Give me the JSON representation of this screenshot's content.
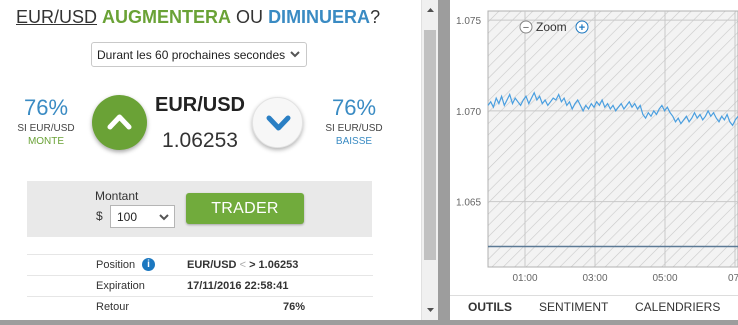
{
  "headline": {
    "pair": "EUR/USD",
    "up_word": "AUGMENTERA",
    "or_word": "OU",
    "down_word": "DIMINUERA",
    "question_mark": "?"
  },
  "duration": {
    "selected": "Durant les 60 prochaines secondes"
  },
  "up": {
    "percent": "76%",
    "si": "SI EUR/USD",
    "label": "MONTE"
  },
  "down": {
    "percent": "76%",
    "si": "SI EUR/USD",
    "label": "BAISSE"
  },
  "asset": {
    "pair": "EUR/USD",
    "price": "1.06253"
  },
  "amount": {
    "label": "Montant",
    "currency": "$",
    "value": "100"
  },
  "trade_button": "TRADER",
  "info": {
    "position_label": "Position",
    "position_pair": "EUR/USD",
    "position_arrow": "<",
    "position_value": "> 1.06253",
    "expiration_label": "Expiration",
    "expiration_value": "17/11/2016 22:58:41",
    "return_label": "Retour",
    "return_value": "76%"
  },
  "chart": {
    "zoom_label": "Zoom",
    "zoom_out": "−",
    "zoom_in": "+"
  },
  "tabs": [
    "OUTILS",
    "SENTIMENT",
    "CALENDRIERS"
  ],
  "colors": {
    "up_green": "#6aa236",
    "down_blue": "#3a8bc3",
    "price_line": "#4a9fe0",
    "strike_line": "#5c7a95"
  },
  "chart_data": {
    "type": "line",
    "y_ticks": [
      "1.075",
      "1.070",
      "1.065"
    ],
    "x_ticks": [
      "01:00",
      "03:00",
      "05:00",
      "07:"
    ],
    "ylim": [
      1.0614,
      1.0755
    ],
    "strike": 1.06253,
    "series": [
      {
        "values": [
          1.0703,
          1.0705,
          1.0702,
          1.0707,
          1.0704,
          1.0708,
          1.0703,
          1.0706,
          1.0709,
          1.0704,
          1.0707,
          1.0705,
          1.0703,
          1.0706,
          1.0708,
          1.0704,
          1.0707,
          1.071,
          1.0706,
          1.0708,
          1.0704,
          1.0706,
          1.0703,
          1.0705,
          1.0707,
          1.0706,
          1.0709,
          1.0705,
          1.0707,
          1.0703,
          1.0705,
          1.0701,
          1.0704,
          1.0706,
          1.0703,
          1.07,
          1.0703,
          1.0701,
          1.0704,
          1.0702,
          1.0705,
          1.0703,
          1.0706,
          1.0702,
          1.0704,
          1.0701,
          1.0703,
          1.07,
          1.0702,
          1.0704,
          1.0701,
          1.0703,
          1.0705,
          1.0702,
          1.0704,
          1.0701,
          1.0703,
          1.0698,
          1.0696,
          1.0699,
          1.0697,
          1.07,
          1.0698,
          1.0701,
          1.0703,
          1.07,
          1.0702,
          1.0699,
          1.0697,
          1.0694,
          1.0696,
          1.0693,
          1.0695,
          1.0697,
          1.0694,
          1.0696,
          1.0699,
          1.0696,
          1.0698,
          1.0695,
          1.0697,
          1.07,
          1.0697,
          1.0699,
          1.0696,
          1.0694,
          1.0697,
          1.0695,
          1.0698,
          1.0694,
          1.0692,
          1.0695,
          1.0697
        ]
      }
    ]
  }
}
